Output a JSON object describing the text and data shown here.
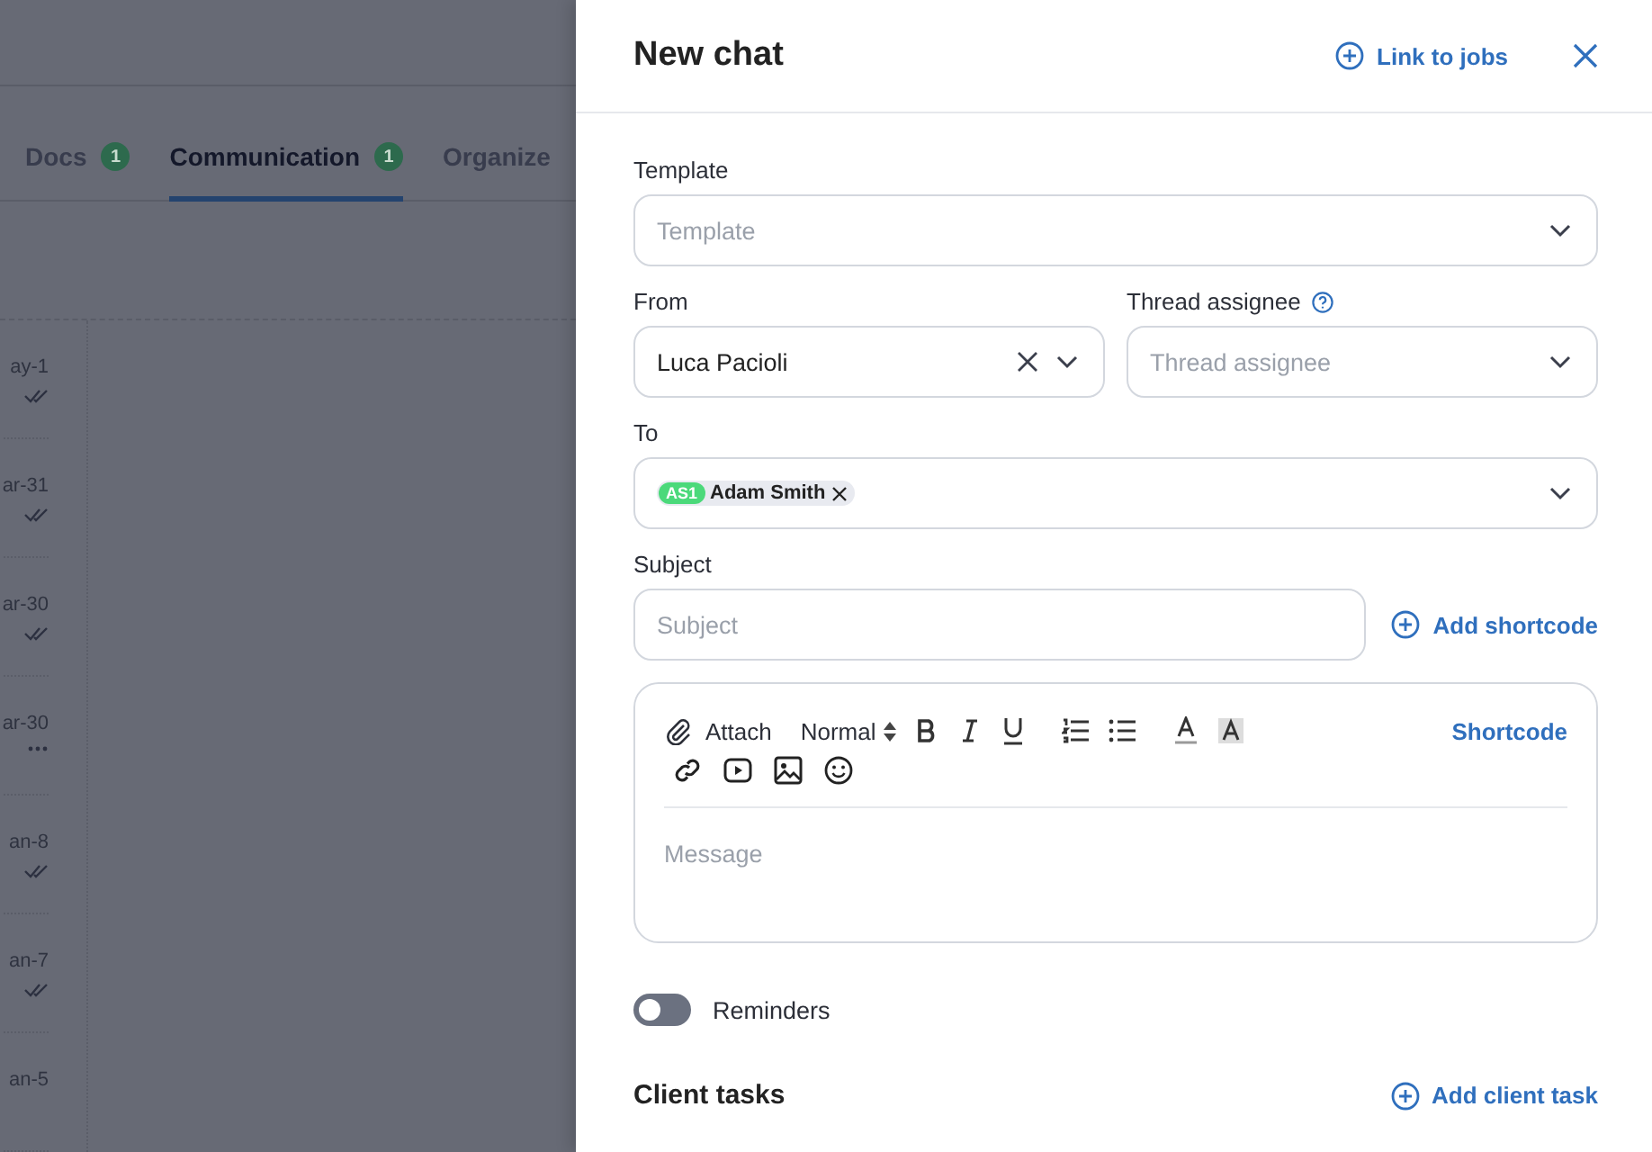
{
  "background": {
    "tabs": [
      {
        "label": "Docs",
        "badge": "1",
        "selected": false
      },
      {
        "label": "Communication",
        "badge": "1",
        "selected": true
      },
      {
        "label": "Organize",
        "selected": false
      }
    ],
    "messages": [
      {
        "date": "ay-1",
        "kind": "read"
      },
      {
        "date": "ar-31",
        "kind": "read"
      },
      {
        "date": "ar-30",
        "kind": "read"
      },
      {
        "date": "ar-30",
        "kind": "pending"
      },
      {
        "date": "an-8",
        "kind": "read"
      },
      {
        "date": "an-7",
        "kind": "read"
      },
      {
        "date": "an-5",
        "kind": "plain"
      }
    ]
  },
  "panel": {
    "title": "New chat",
    "link_to_jobs": "Link to jobs",
    "template": {
      "label": "Template",
      "placeholder": "Template"
    },
    "from": {
      "label": "From",
      "value": "Luca Pacioli"
    },
    "thread_assignee": {
      "label": "Thread assignee",
      "placeholder": "Thread assignee"
    },
    "to": {
      "label": "To",
      "recipients": [
        {
          "initials": "AS1",
          "name": "Adam Smith"
        }
      ]
    },
    "subject": {
      "label": "Subject",
      "placeholder": "Subject"
    },
    "add_shortcode": "Add shortcode",
    "editor": {
      "attach": "Attach",
      "format": "Normal",
      "shortcode": "Shortcode",
      "placeholder": "Message"
    },
    "reminders": {
      "label": "Reminders",
      "on": false
    },
    "client_tasks": {
      "title": "Client tasks",
      "add": "Add client task"
    }
  }
}
